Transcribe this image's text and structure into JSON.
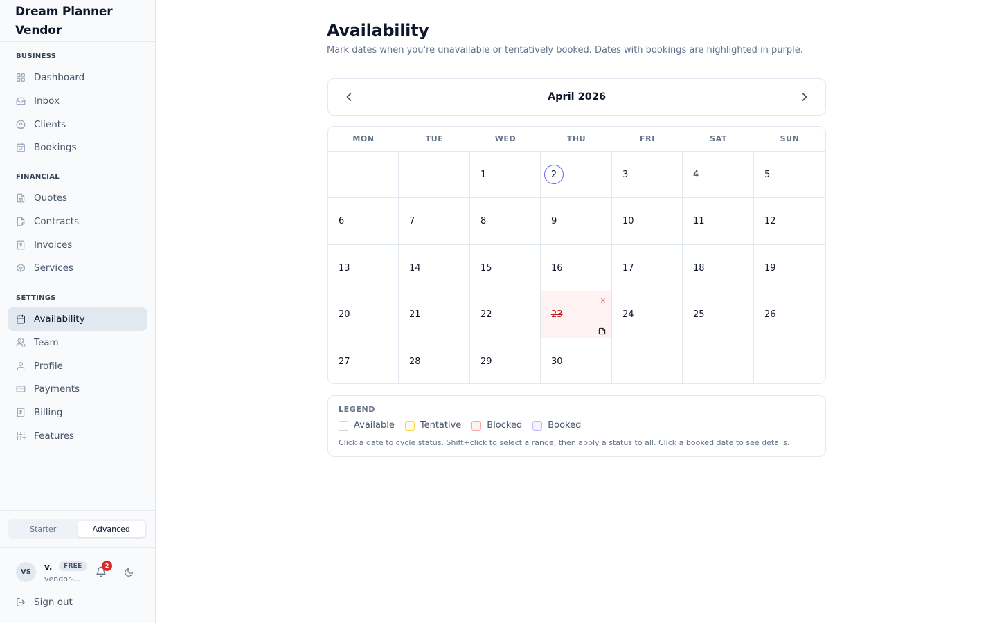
{
  "brand": {
    "line1": "Dream Planner",
    "line2": "Vendor"
  },
  "sidebar": {
    "sections": [
      {
        "title": "BUSINESS",
        "items": [
          {
            "label": "Dashboard",
            "icon": "dashboard-icon"
          },
          {
            "label": "Inbox",
            "icon": "inbox-icon"
          },
          {
            "label": "Clients",
            "icon": "user-circle-icon"
          },
          {
            "label": "Bookings",
            "icon": "calendar-check-icon"
          }
        ]
      },
      {
        "title": "FINANCIAL",
        "items": [
          {
            "label": "Quotes",
            "icon": "file-text-icon"
          },
          {
            "label": "Contracts",
            "icon": "file-signature-icon"
          },
          {
            "label": "Invoices",
            "icon": "invoice-icon"
          },
          {
            "label": "Services",
            "icon": "package-icon"
          }
        ]
      },
      {
        "title": "SETTINGS",
        "items": [
          {
            "label": "Availability",
            "icon": "calendar-icon",
            "active": true
          },
          {
            "label": "Team",
            "icon": "users-icon"
          },
          {
            "label": "Profile",
            "icon": "user-icon"
          },
          {
            "label": "Payments",
            "icon": "credit-card-icon"
          },
          {
            "label": "Billing",
            "icon": "receipt-icon"
          },
          {
            "label": "Features",
            "icon": "sliders-icon"
          }
        ]
      }
    ],
    "plan_toggle": {
      "starter": "Starter",
      "advanced": "Advanced",
      "selected": "Advanced"
    },
    "user": {
      "initials": "VS",
      "name": "v.",
      "plan": "FREE",
      "email": "vendor-...",
      "notifications": "2"
    },
    "sign_out": "Sign out"
  },
  "page": {
    "title": "Availability",
    "subtitle": "Mark dates when you're unavailable or tentatively booked. Dates with bookings are highlighted in purple."
  },
  "calendar": {
    "month_label": "April 2026",
    "weekdays": [
      "MON",
      "TUE",
      "WED",
      "THU",
      "FRI",
      "SAT",
      "SUN"
    ],
    "weeks": [
      [
        "",
        "",
        "1",
        "2",
        "3",
        "4",
        "5"
      ],
      [
        "6",
        "7",
        "8",
        "9",
        "10",
        "11",
        "12"
      ],
      [
        "13",
        "14",
        "15",
        "16",
        "17",
        "18",
        "19"
      ],
      [
        "20",
        "21",
        "22",
        "23",
        "24",
        "25",
        "26"
      ],
      [
        "27",
        "28",
        "29",
        "30",
        "",
        "",
        ""
      ]
    ],
    "today": "2",
    "blocked_days": [
      "23"
    ],
    "blocked_mark": "×"
  },
  "legend": {
    "title": "LEGEND",
    "items": [
      {
        "label": "Available",
        "fill": "#ffffff",
        "border": "#cbd5e1"
      },
      {
        "label": "Tentative",
        "fill": "#fffbeb",
        "border": "#fcd34d"
      },
      {
        "label": "Blocked",
        "fill": "#fef2f2",
        "border": "#fca5a5"
      },
      {
        "label": "Booked",
        "fill": "#f5f3ff",
        "border": "#c4b5fd"
      }
    ],
    "hint": "Click a date to cycle status. Shift+click to select a range, then apply a status to all. Click a booked date to see details."
  },
  "colors": {
    "accent": "#6366f1",
    "blocked_bg": "#fef2f2",
    "blocked_text": "#b91c1c",
    "badge_red": "#dc2626"
  }
}
